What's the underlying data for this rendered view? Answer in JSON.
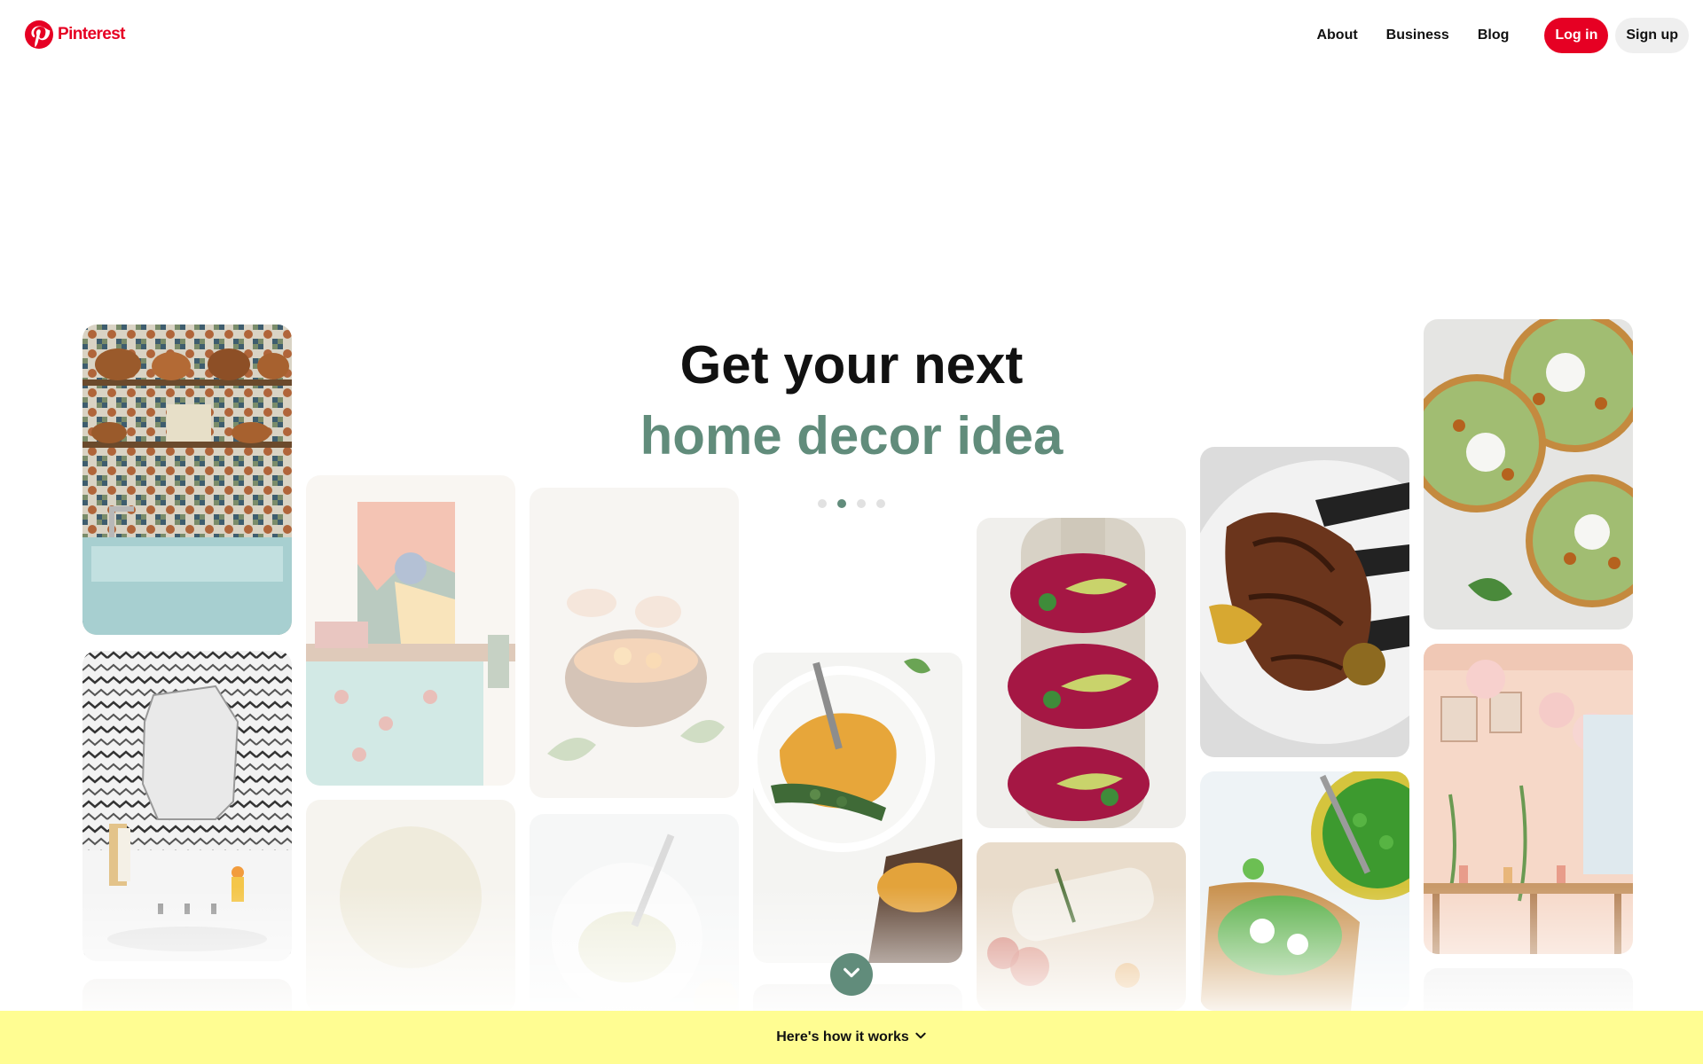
{
  "brand": {
    "name": "Pinterest",
    "color": "#e60023",
    "icon": "pinterest-logo-icon"
  },
  "nav": {
    "about": "About",
    "business": "Business",
    "blog": "Blog",
    "login": "Log in",
    "signup": "Sign up"
  },
  "hero": {
    "line1": "Get your next",
    "line2": "home decor idea",
    "accent_color": "#618c7b",
    "carousel": {
      "total": 4,
      "active_index": 2
    }
  },
  "pins": [
    {
      "subject": "Tiled kitchen wall with copper pots"
    },
    {
      "subject": "Bathroom with patterned wallpaper and mirror"
    },
    {
      "subject": "Bedroom with colorful abstract painting"
    },
    {
      "subject": "Hands garnishing a wooden bowl of food"
    },
    {
      "subject": "Bowl of pasta with spoon"
    },
    {
      "subject": "Hummus bowl with greens and crackers"
    },
    {
      "subject": "Beet and avocado toasts on board"
    },
    {
      "subject": "Wrapped bread with rosemary and wine"
    },
    {
      "subject": "Grilled chicken on striped plate"
    },
    {
      "subject": "Pea and feta toast with bowl of peas"
    },
    {
      "subject": "Flatbreads topped with chickpeas and sauce"
    },
    {
      "subject": "Pink party room with balloons"
    }
  ],
  "scroll_icon": "chevron-down-icon",
  "banner": {
    "text": "Here's how it works",
    "icon": "chevron-down-icon",
    "background": "#fffd92"
  }
}
